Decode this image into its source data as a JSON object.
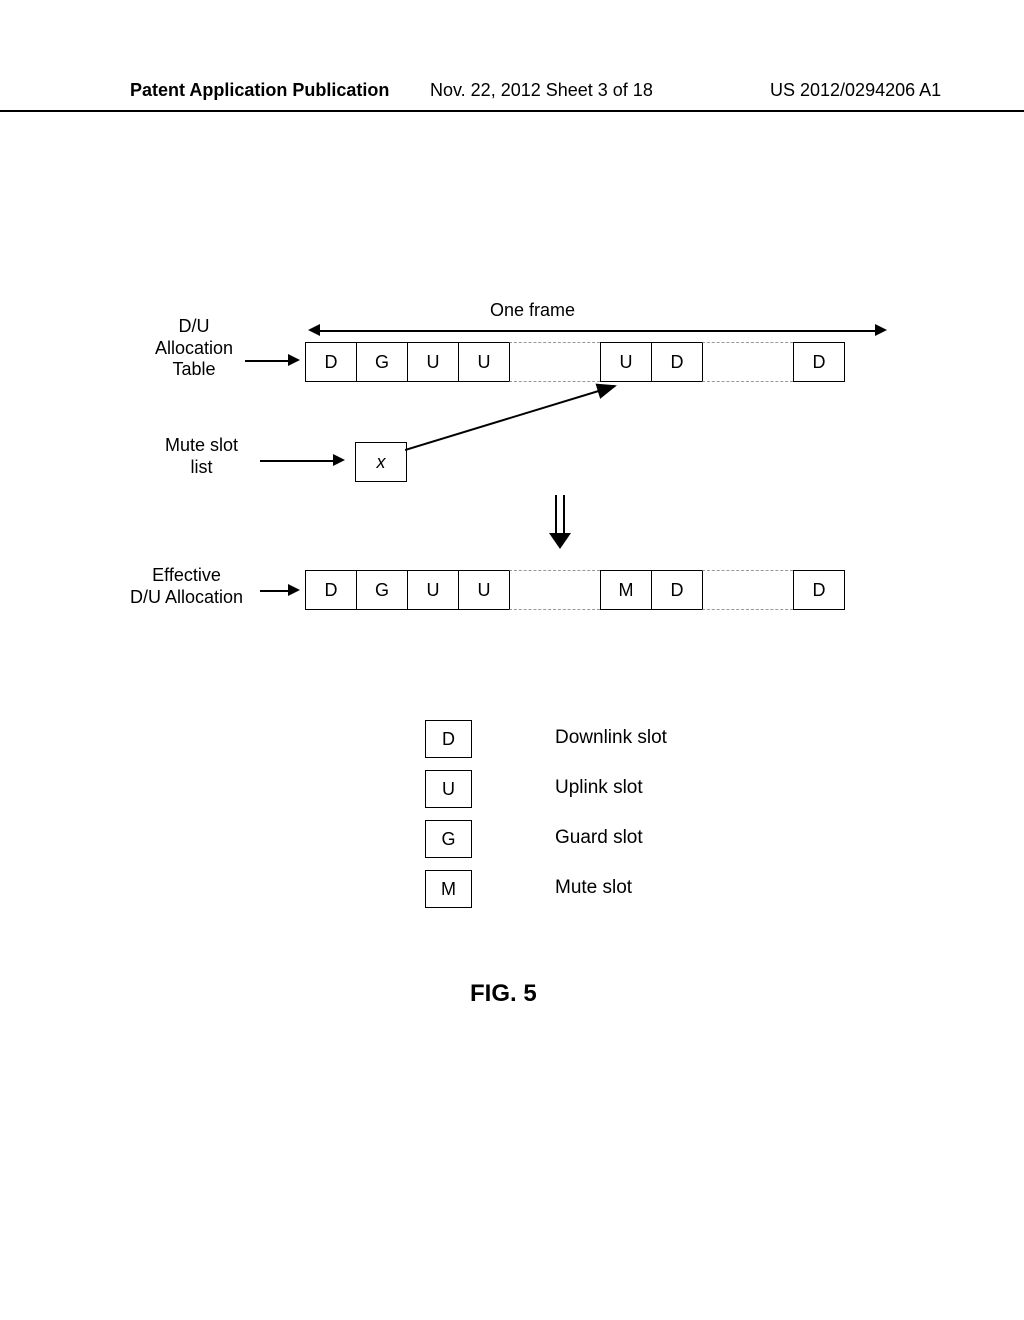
{
  "header": {
    "left": "Patent Application Publication",
    "mid": "Nov. 22, 2012  Sheet 3 of 18",
    "right": "US 2012/0294206 A1"
  },
  "labels": {
    "one_frame": "One frame",
    "allocation_table": "D/U\nAllocation\nTable",
    "mute_slot_list": "Mute slot\nlist",
    "effective": "Effective\nD/U Allocation",
    "fig": "FIG. 5"
  },
  "row1": [
    "D",
    "G",
    "U",
    "U",
    "",
    "U",
    "D",
    "",
    "D"
  ],
  "muteSlot": "x",
  "row3": [
    "D",
    "G",
    "U",
    "U",
    "",
    "M",
    "D",
    "",
    "D"
  ],
  "legend": {
    "d": {
      "sym": "D",
      "text": "Downlink slot"
    },
    "u": {
      "sym": "U",
      "text": "Uplink slot"
    },
    "g": {
      "sym": "G",
      "text": "Guard slot"
    },
    "m": {
      "sym": "M",
      "text": "Mute slot"
    }
  }
}
